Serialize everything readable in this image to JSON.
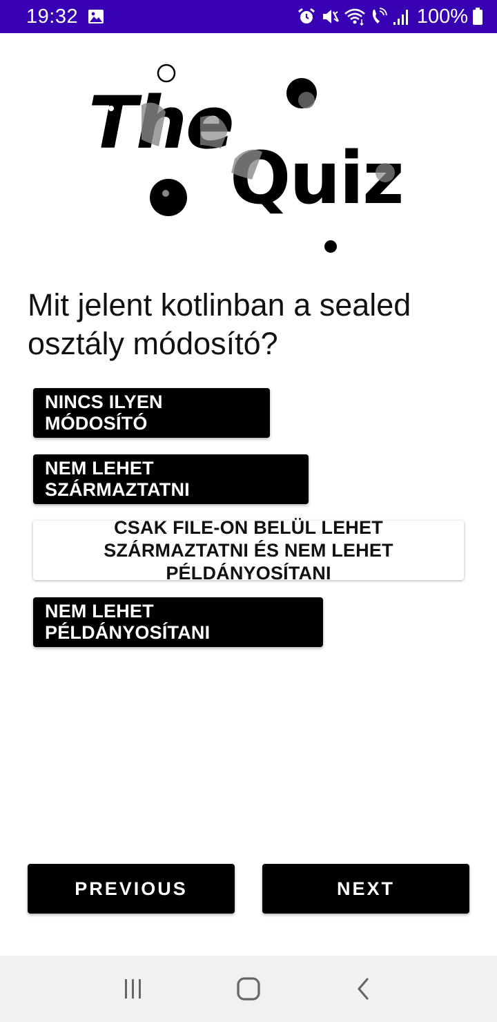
{
  "status_bar": {
    "time": "19:32",
    "battery": "100%",
    "icons": [
      "gallery-icon",
      "alarm-icon",
      "mute-icon",
      "wifi-icon",
      "wifi-call-icon",
      "signal-icon",
      "battery-icon"
    ],
    "background": "#3700b3"
  },
  "logo": {
    "word1": "The",
    "word2": "Quiz"
  },
  "question": "Mit jelent kotlinban a sealed osztály módosító?",
  "answers": [
    {
      "label": "NINCS ILYEN MÓDOSÍTÓ",
      "selected": false
    },
    {
      "label": "NEM LEHET SZÁRMAZTATNI",
      "selected": false
    },
    {
      "label": "CSAK FILE-ON BELÜL LEHET SZÁRMAZTATNI ÉS NEM LEHET PÉLDÁNYOSÍTANI",
      "selected": true
    },
    {
      "label": "NEM LEHET PÉLDÁNYOSÍTANI",
      "selected": false
    }
  ],
  "navigation": {
    "previous_label": "PREVIOUS",
    "next_label": "NEXT"
  },
  "system_nav": {
    "icons": [
      "recents-icon",
      "home-icon",
      "back-icon"
    ]
  }
}
